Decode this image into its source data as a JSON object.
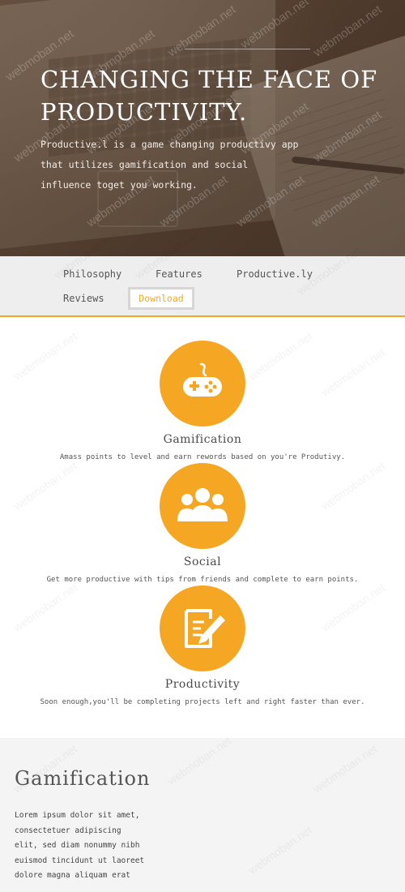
{
  "hero": {
    "title": "CHANGING THE FACE OF PRODUCTIVITY.",
    "subtitle": "Productive.l is a game changing productivy app that utilizes gamification and social influence toget you working."
  },
  "nav": {
    "items": [
      {
        "label": "Philosophy"
      },
      {
        "label": "Features"
      },
      {
        "label": "Productive.ly"
      },
      {
        "label": "Reviews"
      }
    ],
    "download_label": "Download"
  },
  "features": [
    {
      "icon": "gamepad-icon",
      "title": "Gamification",
      "desc": "Amass points to level and earn rewords based on you're Produtivy."
    },
    {
      "icon": "people-icon",
      "title": "Social",
      "desc": "Get more productive with tips from friends and complete to earn points."
    },
    {
      "icon": "edit-document-icon",
      "title": "Productivity",
      "desc": "Soon enough,you'll be completing projects left and right faster than ever."
    }
  ],
  "gamification_section": {
    "heading": "Gamification",
    "body": "Lorem ipsum dolor sit amet, consectetuer adipiscing elit, sed diam nonummy nibh euismod tincidunt ut laoreet dolore magna aliquam erat"
  },
  "watermark": "webmoban.net",
  "colors": {
    "accent": "#f5a623",
    "nav_bg": "#eeeeee",
    "section_bg": "#f4f4f4"
  }
}
